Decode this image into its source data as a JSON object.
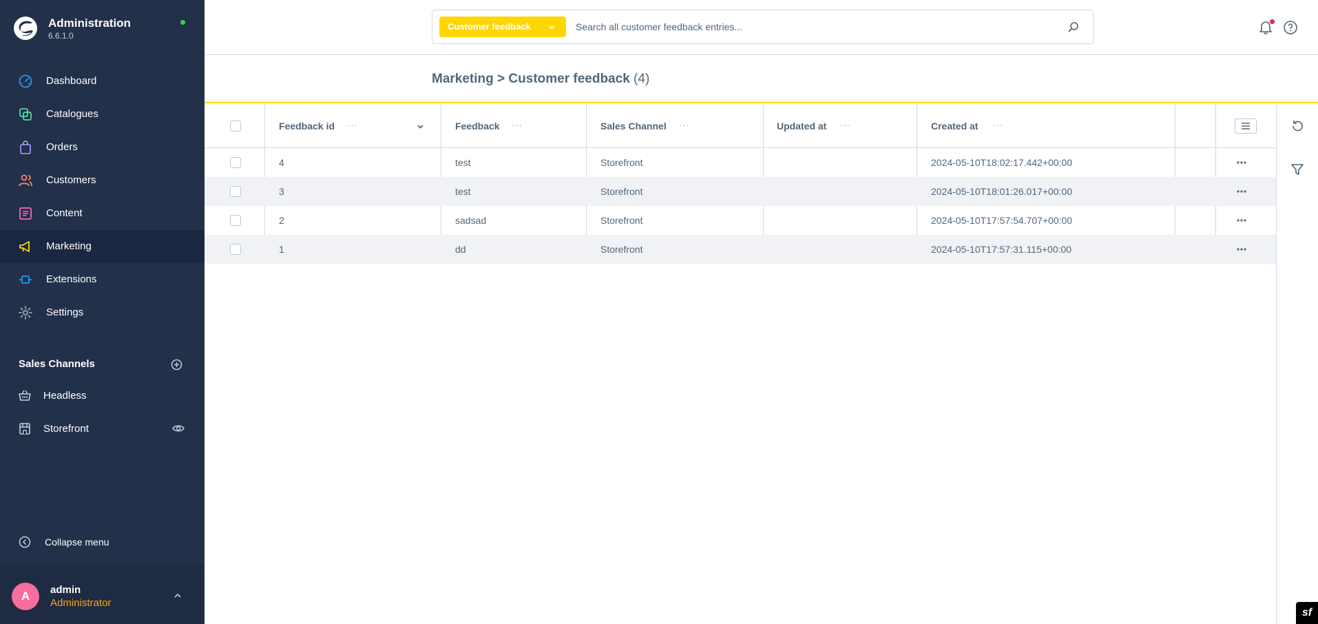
{
  "app": {
    "title": "Administration",
    "version": "6.6.1.0",
    "status_color": "#37d046"
  },
  "sidebar": {
    "items": [
      {
        "label": "Dashboard",
        "icon": "dashboard-icon",
        "color": "#3498db"
      },
      {
        "label": "Catalogues",
        "icon": "catalogue-icon",
        "color": "#57d9a3"
      },
      {
        "label": "Orders",
        "icon": "orders-bag-icon",
        "color": "#a092f0"
      },
      {
        "label": "Customers",
        "icon": "customers-icon",
        "color": "#f88962"
      },
      {
        "label": "Content",
        "icon": "content-icon",
        "color": "#ff68b4"
      },
      {
        "label": "Marketing",
        "icon": "megaphone-icon",
        "color": "#ffd700",
        "active": true
      },
      {
        "label": "Extensions",
        "icon": "plugin-icon",
        "color": "#189eff"
      },
      {
        "label": "Settings",
        "icon": "gear-icon",
        "color": "#9aa8b5"
      }
    ],
    "sales_channels_title": "Sales Channels",
    "sales_channels": [
      {
        "label": "Headless",
        "icon": "basket-icon"
      },
      {
        "label": "Storefront",
        "icon": "storefront-icon"
      }
    ],
    "collapse_label": "Collapse menu",
    "user": {
      "initial": "A",
      "name": "admin",
      "role": "Administrator",
      "avatar_color": "#f76d9e",
      "role_color": "#ffa21a"
    }
  },
  "search": {
    "type_label": "Customer feedback",
    "placeholder": "Search all customer feedback entries...",
    "accent": "#ffd700"
  },
  "page": {
    "breadcrumb_parent": "Marketing",
    "separator": ">",
    "title": "Customer feedback",
    "count": "(4)"
  },
  "grid": {
    "columns": [
      "Feedback id",
      "Feedback",
      "Sales Channel",
      "Updated at",
      "Created at"
    ],
    "rows": [
      {
        "id": "4",
        "feedback": "test",
        "channel": "Storefront",
        "updated": "",
        "created": "2024-05-10T18:02:17.442+00:00"
      },
      {
        "id": "3",
        "feedback": "test",
        "channel": "Storefront",
        "updated": "",
        "created": "2024-05-10T18:01:26.017+00:00"
      },
      {
        "id": "2",
        "feedback": "sadsad",
        "channel": "Storefront",
        "updated": "",
        "created": "2024-05-10T17:57:54.707+00:00"
      },
      {
        "id": "1",
        "feedback": "dd",
        "channel": "Storefront",
        "updated": "",
        "created": "2024-05-10T17:57:31.115+00:00"
      }
    ]
  },
  "right_sidebar": {
    "icons": [
      "refresh-icon",
      "filter-icon"
    ]
  },
  "debug_badge": "sf"
}
